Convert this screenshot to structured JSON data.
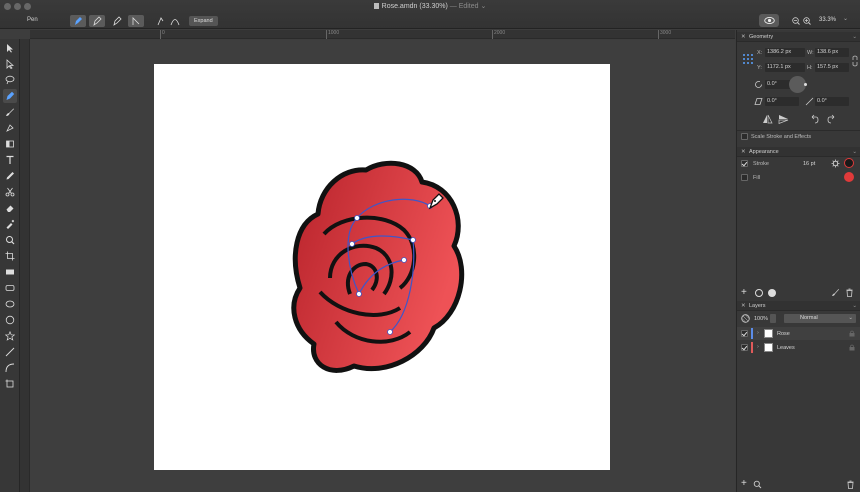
{
  "window": {
    "title": "Rose.amdn (33.30%)",
    "edited": "— Edited ⌄"
  },
  "context_bar": {
    "tool_name": "Pen",
    "expand_label": "Expand",
    "zoom": "33.3%"
  },
  "rulers": {
    "h_labels": [
      "0",
      "1000",
      "2000",
      "3000"
    ]
  },
  "tools": [
    "move-tool",
    "direct-selection-tool",
    "lasso-tool",
    "pen-tool",
    "brush-tool",
    "paint-tool",
    "eraser-tool",
    "text-tool",
    "pencil-tool",
    "scissors-tool",
    "fill-tool",
    "eyedropper-tool",
    "zoom-tool",
    "crop-tool",
    "rectangle-tool",
    "rounded-rect-tool",
    "ellipse-tool",
    "circle-tool",
    "star-tool",
    "line-tool",
    "arc-tool",
    "artboard-tool"
  ],
  "geometry": {
    "title": "Geometry",
    "x_label": "X:",
    "x_value": "1386.2 px",
    "w_label": "W:",
    "w_value": "138.6 px",
    "y_label": "Y:",
    "y_value": "1172.1 px",
    "h_label": "H:",
    "h_value": "157.5 px",
    "rotation": "0.0°",
    "shear": "0.0°",
    "skew": "0.0°",
    "scale_label": "Scale Stroke and Effects"
  },
  "appearance": {
    "title": "Appearance",
    "stroke_label": "Stroke",
    "stroke_value": "16 pt",
    "fill_label": "Fill",
    "stroke_color": "#1a1a1a",
    "fill_color": "#e03a3a"
  },
  "layers": {
    "title": "Layers",
    "opacity": "100%",
    "blend": "Normal",
    "items": [
      {
        "name": "Rose",
        "color": "#5b8ce8"
      },
      {
        "name": "Leaves",
        "color": "#e05a5a"
      }
    ]
  }
}
